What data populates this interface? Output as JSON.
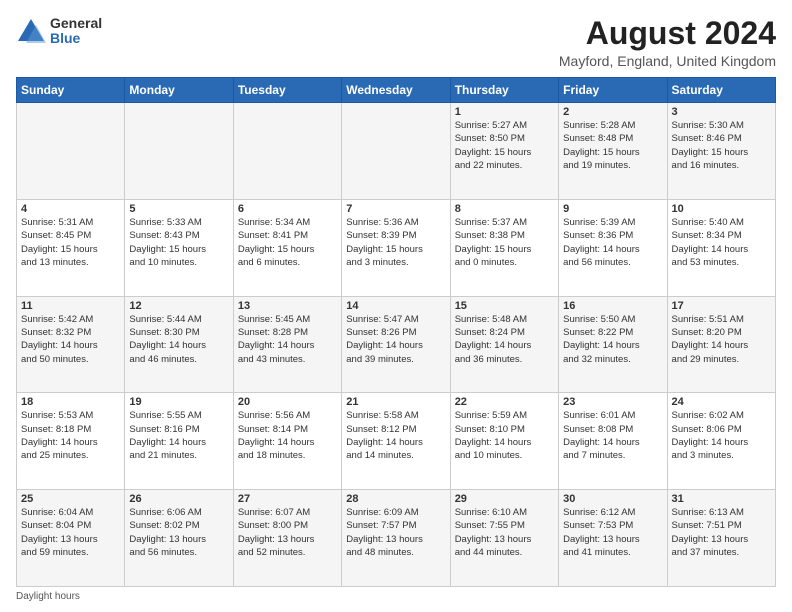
{
  "header": {
    "logo_general": "General",
    "logo_blue": "Blue",
    "main_title": "August 2024",
    "subtitle": "Mayford, England, United Kingdom"
  },
  "footer": {
    "note": "Daylight hours"
  },
  "days_of_week": [
    "Sunday",
    "Monday",
    "Tuesday",
    "Wednesday",
    "Thursday",
    "Friday",
    "Saturday"
  ],
  "weeks": [
    [
      {
        "day": "",
        "info": ""
      },
      {
        "day": "",
        "info": ""
      },
      {
        "day": "",
        "info": ""
      },
      {
        "day": "",
        "info": ""
      },
      {
        "day": "1",
        "info": "Sunrise: 5:27 AM\nSunset: 8:50 PM\nDaylight: 15 hours\nand 22 minutes."
      },
      {
        "day": "2",
        "info": "Sunrise: 5:28 AM\nSunset: 8:48 PM\nDaylight: 15 hours\nand 19 minutes."
      },
      {
        "day": "3",
        "info": "Sunrise: 5:30 AM\nSunset: 8:46 PM\nDaylight: 15 hours\nand 16 minutes."
      }
    ],
    [
      {
        "day": "4",
        "info": "Sunrise: 5:31 AM\nSunset: 8:45 PM\nDaylight: 15 hours\nand 13 minutes."
      },
      {
        "day": "5",
        "info": "Sunrise: 5:33 AM\nSunset: 8:43 PM\nDaylight: 15 hours\nand 10 minutes."
      },
      {
        "day": "6",
        "info": "Sunrise: 5:34 AM\nSunset: 8:41 PM\nDaylight: 15 hours\nand 6 minutes."
      },
      {
        "day": "7",
        "info": "Sunrise: 5:36 AM\nSunset: 8:39 PM\nDaylight: 15 hours\nand 3 minutes."
      },
      {
        "day": "8",
        "info": "Sunrise: 5:37 AM\nSunset: 8:38 PM\nDaylight: 15 hours\nand 0 minutes."
      },
      {
        "day": "9",
        "info": "Sunrise: 5:39 AM\nSunset: 8:36 PM\nDaylight: 14 hours\nand 56 minutes."
      },
      {
        "day": "10",
        "info": "Sunrise: 5:40 AM\nSunset: 8:34 PM\nDaylight: 14 hours\nand 53 minutes."
      }
    ],
    [
      {
        "day": "11",
        "info": "Sunrise: 5:42 AM\nSunset: 8:32 PM\nDaylight: 14 hours\nand 50 minutes."
      },
      {
        "day": "12",
        "info": "Sunrise: 5:44 AM\nSunset: 8:30 PM\nDaylight: 14 hours\nand 46 minutes."
      },
      {
        "day": "13",
        "info": "Sunrise: 5:45 AM\nSunset: 8:28 PM\nDaylight: 14 hours\nand 43 minutes."
      },
      {
        "day": "14",
        "info": "Sunrise: 5:47 AM\nSunset: 8:26 PM\nDaylight: 14 hours\nand 39 minutes."
      },
      {
        "day": "15",
        "info": "Sunrise: 5:48 AM\nSunset: 8:24 PM\nDaylight: 14 hours\nand 36 minutes."
      },
      {
        "day": "16",
        "info": "Sunrise: 5:50 AM\nSunset: 8:22 PM\nDaylight: 14 hours\nand 32 minutes."
      },
      {
        "day": "17",
        "info": "Sunrise: 5:51 AM\nSunset: 8:20 PM\nDaylight: 14 hours\nand 29 minutes."
      }
    ],
    [
      {
        "day": "18",
        "info": "Sunrise: 5:53 AM\nSunset: 8:18 PM\nDaylight: 14 hours\nand 25 minutes."
      },
      {
        "day": "19",
        "info": "Sunrise: 5:55 AM\nSunset: 8:16 PM\nDaylight: 14 hours\nand 21 minutes."
      },
      {
        "day": "20",
        "info": "Sunrise: 5:56 AM\nSunset: 8:14 PM\nDaylight: 14 hours\nand 18 minutes."
      },
      {
        "day": "21",
        "info": "Sunrise: 5:58 AM\nSunset: 8:12 PM\nDaylight: 14 hours\nand 14 minutes."
      },
      {
        "day": "22",
        "info": "Sunrise: 5:59 AM\nSunset: 8:10 PM\nDaylight: 14 hours\nand 10 minutes."
      },
      {
        "day": "23",
        "info": "Sunrise: 6:01 AM\nSunset: 8:08 PM\nDaylight: 14 hours\nand 7 minutes."
      },
      {
        "day": "24",
        "info": "Sunrise: 6:02 AM\nSunset: 8:06 PM\nDaylight: 14 hours\nand 3 minutes."
      }
    ],
    [
      {
        "day": "25",
        "info": "Sunrise: 6:04 AM\nSunset: 8:04 PM\nDaylight: 13 hours\nand 59 minutes."
      },
      {
        "day": "26",
        "info": "Sunrise: 6:06 AM\nSunset: 8:02 PM\nDaylight: 13 hours\nand 56 minutes."
      },
      {
        "day": "27",
        "info": "Sunrise: 6:07 AM\nSunset: 8:00 PM\nDaylight: 13 hours\nand 52 minutes."
      },
      {
        "day": "28",
        "info": "Sunrise: 6:09 AM\nSunset: 7:57 PM\nDaylight: 13 hours\nand 48 minutes."
      },
      {
        "day": "29",
        "info": "Sunrise: 6:10 AM\nSunset: 7:55 PM\nDaylight: 13 hours\nand 44 minutes."
      },
      {
        "day": "30",
        "info": "Sunrise: 6:12 AM\nSunset: 7:53 PM\nDaylight: 13 hours\nand 41 minutes."
      },
      {
        "day": "31",
        "info": "Sunrise: 6:13 AM\nSunset: 7:51 PM\nDaylight: 13 hours\nand 37 minutes."
      }
    ]
  ]
}
